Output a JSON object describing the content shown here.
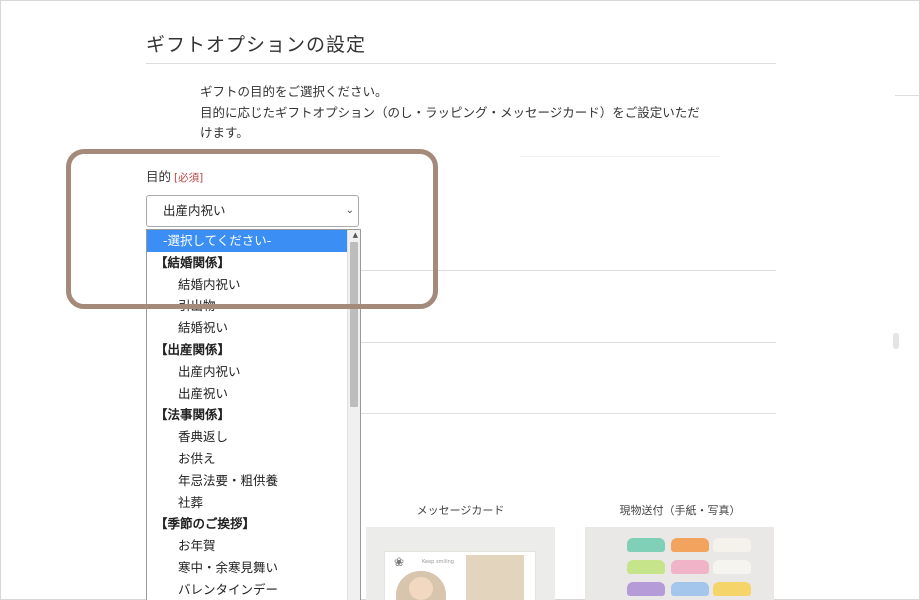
{
  "page": {
    "title": "ギフトオプションの設定",
    "description_line1": "ギフトの目的をご選択ください。",
    "description_line2": "目的に応じたギフトオプション（のし・ラッピング・メッセージカード）をご設定いただ",
    "description_line3": "けます。"
  },
  "purpose_field": {
    "label": "目的",
    "required_badge": "[必須]",
    "selected_value": "出産内祝い",
    "chevron_icon": "chevron-down-icon"
  },
  "dropdown": {
    "highlighted": "-選択してください-",
    "items": [
      {
        "type": "group",
        "label": "【結婚関係】"
      },
      {
        "type": "option",
        "label": "結婚内祝い"
      },
      {
        "type": "option",
        "label": "引出物"
      },
      {
        "type": "option",
        "label": "結婚祝い"
      },
      {
        "type": "group",
        "label": "【出産関係】"
      },
      {
        "type": "option",
        "label": "出産内祝い"
      },
      {
        "type": "option",
        "label": "出産祝い"
      },
      {
        "type": "group",
        "label": "【法事関係】"
      },
      {
        "type": "option",
        "label": "香典返し"
      },
      {
        "type": "option",
        "label": "お供え"
      },
      {
        "type": "option",
        "label": "年忌法要・粗供養"
      },
      {
        "type": "option",
        "label": "社葬"
      },
      {
        "type": "group",
        "label": "【季節のご挨拶】"
      },
      {
        "type": "option",
        "label": "お年賀"
      },
      {
        "type": "option",
        "label": "寒中・余寒見舞い"
      },
      {
        "type": "option",
        "label": "バレンタインデー"
      }
    ]
  },
  "option_columns": {
    "message_card": "メッセージカード",
    "item_delivery": "現物送付（手紙・写真）"
  },
  "message_card_image": {
    "script_text": "Keep smiling"
  },
  "colors": {
    "highlight": "#3b8ff4",
    "annotation_border": "#a48a7a",
    "required": "#b44444"
  }
}
